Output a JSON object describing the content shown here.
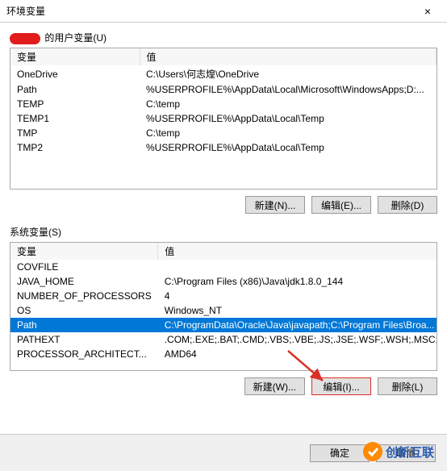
{
  "titlebar": {
    "title": "环境变量"
  },
  "userVars": {
    "label_prefix_hidden": true,
    "label": "的用户变量(U)",
    "cols": {
      "name": "变量",
      "value": "值"
    },
    "rows": [
      {
        "name": "OneDrive",
        "value": "C:\\Users\\何志煌\\OneDrive"
      },
      {
        "name": "Path",
        "value": "%USERPROFILE%\\AppData\\Local\\Microsoft\\WindowsApps;D:..."
      },
      {
        "name": "TEMP",
        "value": "C:\\temp"
      },
      {
        "name": "TEMP1",
        "value": "%USERPROFILE%\\AppData\\Local\\Temp"
      },
      {
        "name": "TMP",
        "value": "C:\\temp"
      },
      {
        "name": "TMP2",
        "value": "%USERPROFILE%\\AppData\\Local\\Temp"
      }
    ],
    "buttons": {
      "new": "新建(N)...",
      "edit": "编辑(E)...",
      "del": "删除(D)"
    }
  },
  "sysVars": {
    "label": "系统变量(S)",
    "cols": {
      "name": "变量",
      "value": "值"
    },
    "selectedIndex": 4,
    "rows": [
      {
        "name": "COVFILE",
        "value": ""
      },
      {
        "name": "JAVA_HOME",
        "value": "C:\\Program Files (x86)\\Java\\jdk1.8.0_144"
      },
      {
        "name": "NUMBER_OF_PROCESSORS",
        "value": "4"
      },
      {
        "name": "OS",
        "value": "Windows_NT"
      },
      {
        "name": "Path",
        "value": "C:\\ProgramData\\Oracle\\Java\\javapath;C:\\Program Files\\Broa..."
      },
      {
        "name": "PATHEXT",
        "value": ".COM;.EXE;.BAT;.CMD;.VBS;.VBE;.JS;.JSE;.WSF;.WSH;.MSC;.PY"
      },
      {
        "name": "PROCESSOR_ARCHITECT...",
        "value": "AMD64"
      }
    ],
    "buttons": {
      "new": "新建(W)...",
      "edit": "编辑(I)...",
      "del": "删除(L)"
    }
  },
  "footer": {
    "ok": "确定",
    "cancel": "取消"
  },
  "watermark": "创新互联"
}
